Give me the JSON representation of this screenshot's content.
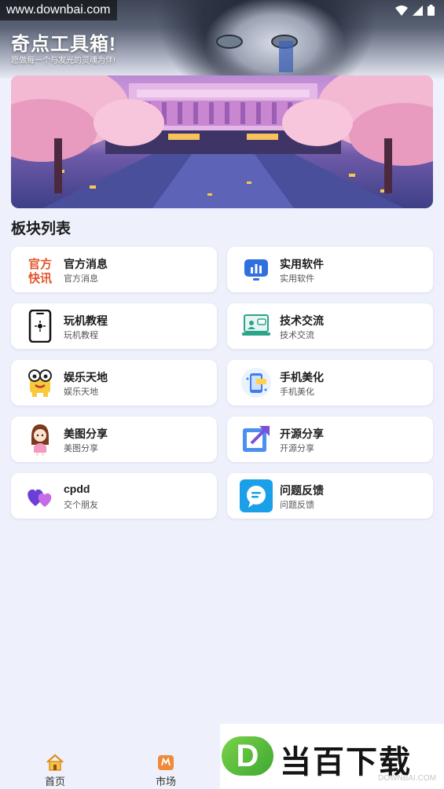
{
  "watermark_top": "www.downbai.com",
  "header": {
    "title": "奇点工具箱!",
    "subtitle": "愿做每一个与发光的灵魂为伴!"
  },
  "section_title": "板块列表",
  "cards": [
    {
      "title": "官方消息",
      "subtitle": "官方消息",
      "icon": "official-news-icon",
      "icon_text": "官方快讯"
    },
    {
      "title": "实用软件",
      "subtitle": "实用软件",
      "icon": "chart-monitor-icon"
    },
    {
      "title": "玩机教程",
      "subtitle": "玩机教程",
      "icon": "phone-icon"
    },
    {
      "title": "技术交流",
      "subtitle": "技术交流",
      "icon": "laptop-chat-icon"
    },
    {
      "title": "娱乐天地",
      "subtitle": "娱乐天地",
      "icon": "emoji-mascot-icon"
    },
    {
      "title": "手机美化",
      "subtitle": "手机美化",
      "icon": "phone-theme-icon"
    },
    {
      "title": "美图分享",
      "subtitle": "美图分享",
      "icon": "girl-avatar-icon"
    },
    {
      "title": "开源分享",
      "subtitle": "开源分享",
      "icon": "share-arrow-icon"
    },
    {
      "title": "cpdd",
      "subtitle": "交个朋友",
      "icon": "hearts-icon"
    },
    {
      "title": "问题反馈",
      "subtitle": "问题反馈",
      "icon": "feedback-chat-icon"
    }
  ],
  "bottom_nav": [
    {
      "label": "首页",
      "icon": "home-icon"
    },
    {
      "label": "市场",
      "icon": "market-bag-icon"
    }
  ],
  "brand": {
    "letter": "D",
    "name": "当百下载",
    "sub": "DOWNBAI.COM"
  },
  "colors": {
    "background": "#eef1fb",
    "card": "#ffffff",
    "accent_blue": "#2f6fe0",
    "brand_green": "#4cb83a"
  }
}
